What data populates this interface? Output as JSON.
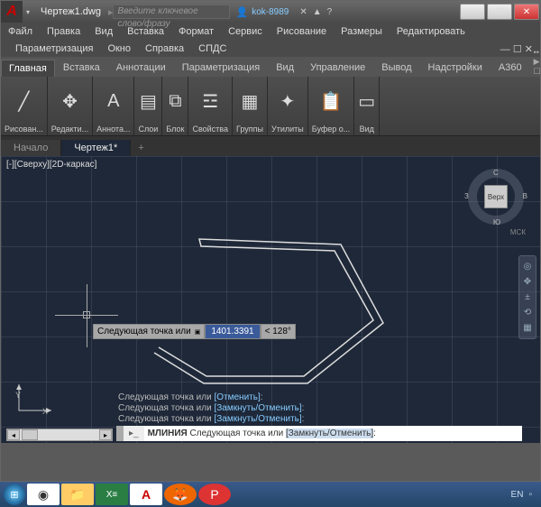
{
  "title": "Чертеж1.dwg",
  "search_placeholder": "Введите ключевое слово/фразу",
  "user": "kok-8989",
  "menu1": [
    "Файл",
    "Правка",
    "Вид",
    "Вставка",
    "Формат",
    "Сервис",
    "Рисование",
    "Размеры",
    "Редактировать"
  ],
  "menu2": [
    "Параметризация",
    "Окно",
    "Справка",
    "СПДС"
  ],
  "ribbon_tabs": [
    "Главная",
    "Вставка",
    "Аннотации",
    "Параметризация",
    "Вид",
    "Управление",
    "Вывод",
    "Надстройки",
    "A360"
  ],
  "ribbon_active": 0,
  "panels": [
    {
      "label": "Рисован...",
      "glyph": "╱"
    },
    {
      "label": "Редакти...",
      "glyph": "✥"
    },
    {
      "label": "Аннота...",
      "glyph": "A"
    },
    {
      "label": "Слои",
      "glyph": "▤"
    },
    {
      "label": "Блок",
      "glyph": "⧉"
    },
    {
      "label": "Свойства",
      "glyph": "☲"
    },
    {
      "label": "Группы",
      "glyph": "▦"
    },
    {
      "label": "Утилиты",
      "glyph": "✦"
    },
    {
      "label": "Буфер о...",
      "glyph": "📋"
    },
    {
      "label": "Вид",
      "glyph": "▭"
    }
  ],
  "doc_tabs": [
    "Начало",
    "Чертеж1*"
  ],
  "doc_active": 1,
  "view_label": "[-][Сверху][2D-каркас]",
  "viewcube": {
    "face": "Верх",
    "n": "С",
    "e": "В",
    "s": "Ю",
    "w": "З",
    "wcs": "МСК"
  },
  "dynamic": {
    "prompt": "Следующая точка или",
    "value": "1401.3391",
    "angle": "< 128°"
  },
  "history": [
    {
      "t": "Следующая точка или ",
      "b": "[Отменить]",
      "c": ":"
    },
    {
      "t": "Следующая точка или ",
      "b": "[Замкнуть/Отменить]",
      "c": ":"
    },
    {
      "t": "Следующая точка или ",
      "b": "[Замкнуть/Отменить]",
      "c": ":"
    }
  ],
  "cmdline": {
    "cmd": "МЛИНИЯ",
    "prompt": " Следующая точка или ",
    "bracket": "[Замкнуть/Отменить]",
    "colon": ":"
  },
  "ucs": {
    "y": "Y",
    "x": "X"
  },
  "tray_lang": "EN"
}
